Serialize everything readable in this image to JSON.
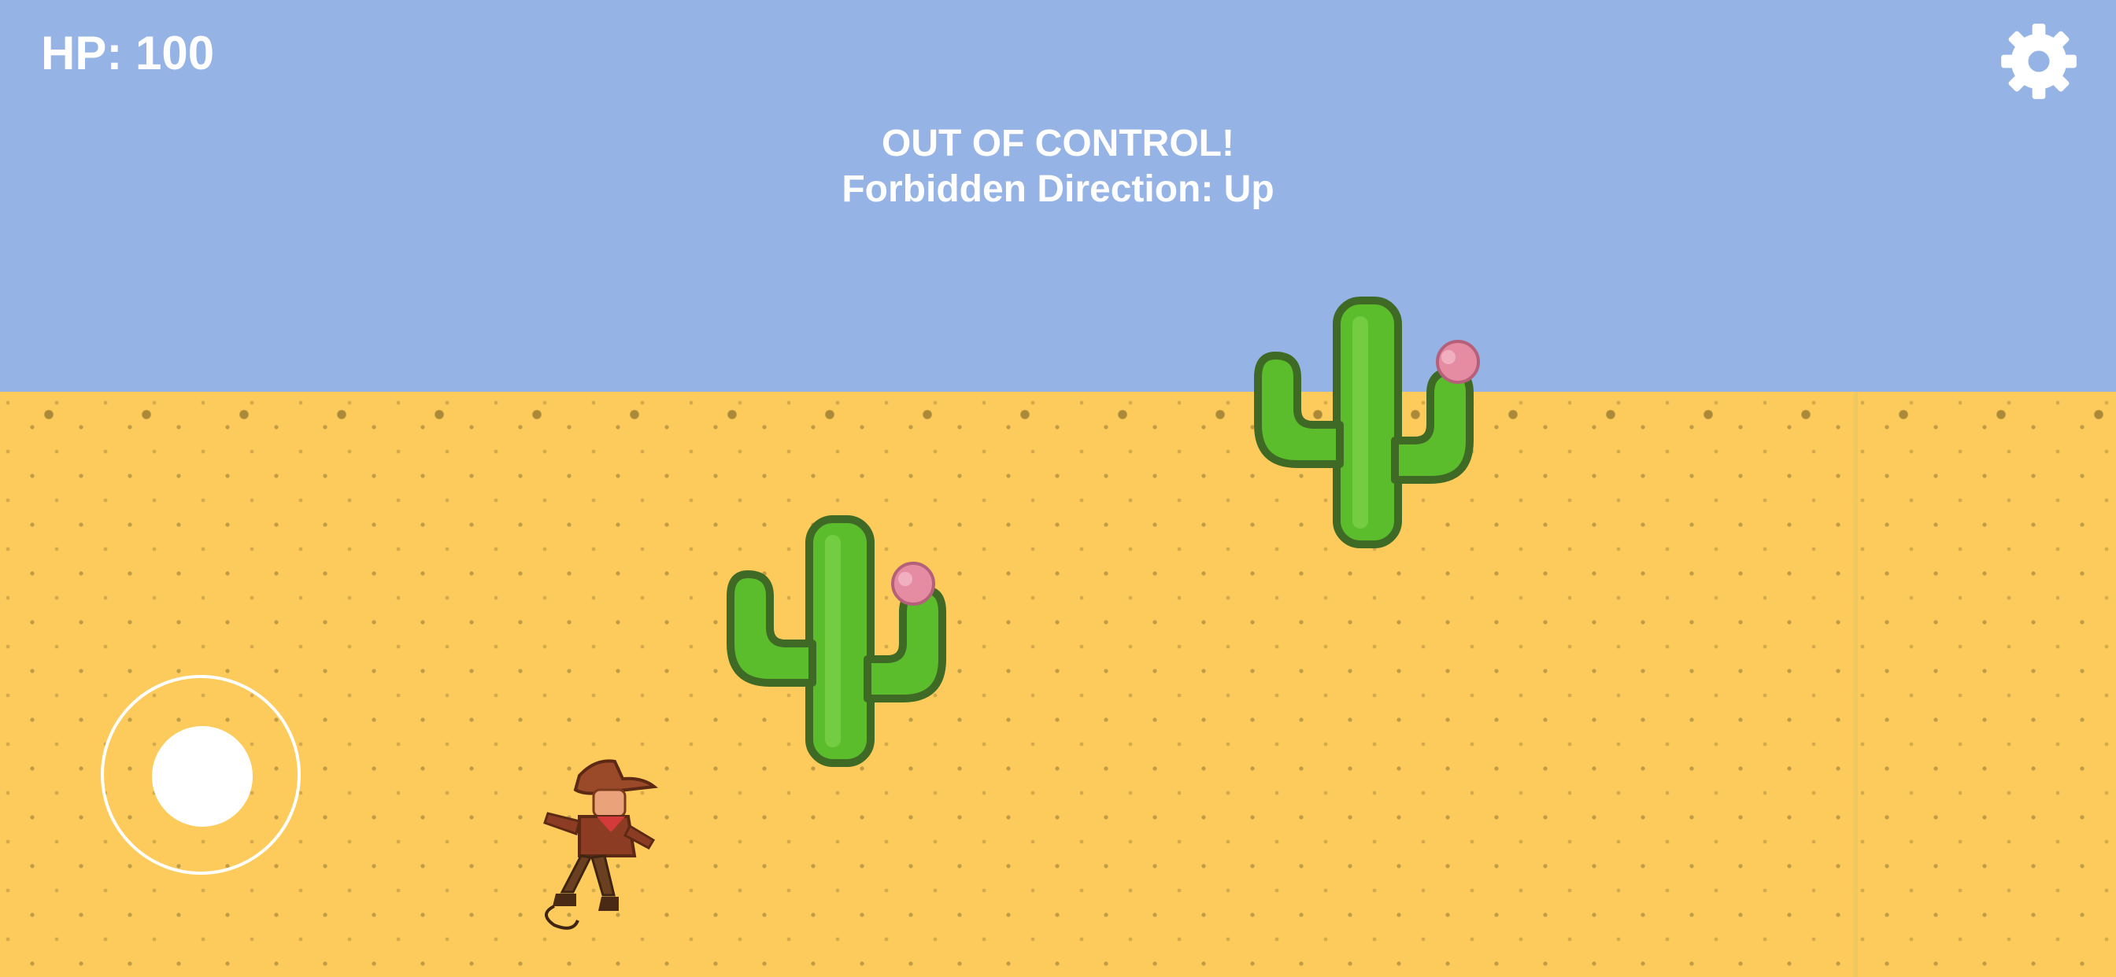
{
  "hud": {
    "hp_label": "HP: 100",
    "status_title": "OUT OF CONTROL!",
    "status_detail": "Forbidden Direction: Up"
  },
  "icons": {
    "settings": "gear-icon",
    "joystick": "virtual-joystick"
  },
  "colors": {
    "sky": "#95b3e5",
    "sand": "#fdcb5b",
    "cactus": "#5bbd2c",
    "flower": "#e58ca3",
    "hud_text": "#ffffff"
  },
  "sprites": [
    "cactus",
    "cactus",
    "cowboy"
  ]
}
